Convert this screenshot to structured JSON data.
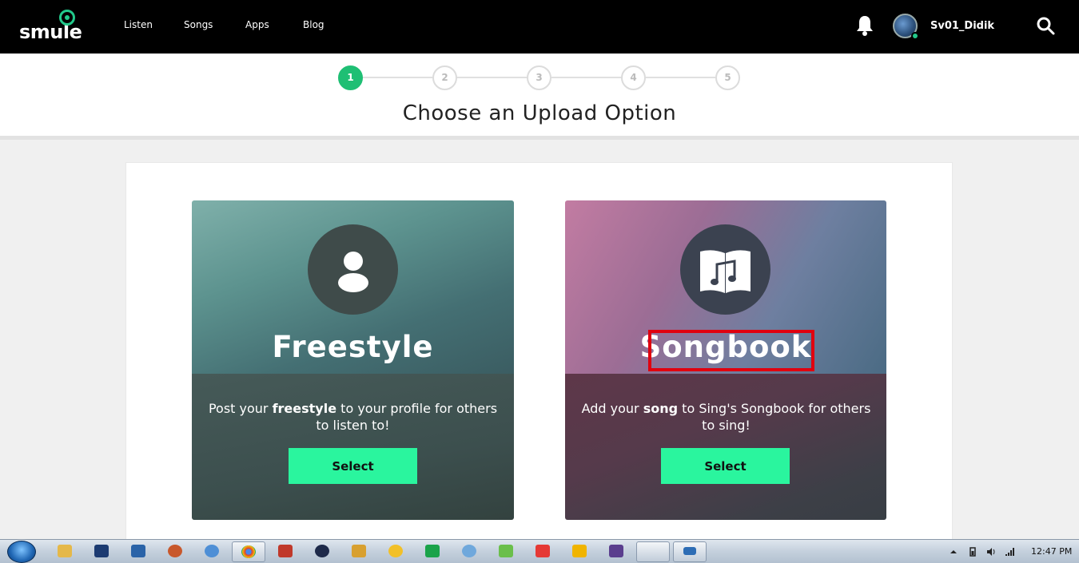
{
  "nav": {
    "logo_text": "smule",
    "links": [
      "Listen",
      "Songs",
      "Apps",
      "Blog"
    ],
    "username": "Sv01_Didik"
  },
  "stepper": {
    "steps": [
      "1",
      "2",
      "3",
      "4",
      "5"
    ],
    "active_step": 1,
    "title": "Choose an Upload Option"
  },
  "cards": {
    "freestyle": {
      "title": "Freestyle",
      "desc_before": "Post your ",
      "desc_bold": "freestyle",
      "desc_after": " to your profile for others to listen to!",
      "button": "Select",
      "icon": "person-icon"
    },
    "songbook": {
      "title": "Songbook",
      "desc_before": "Add your ",
      "desc_bold": "song",
      "desc_after": " to Sing's Songbook for others to sing!",
      "button": "Select",
      "icon": "songbook-icon"
    }
  },
  "taskbar": {
    "clock": "12:47 PM"
  },
  "colors": {
    "accent_green": "#1fbf74",
    "select_button": "#2af59e",
    "highlight_red": "#e0000f"
  }
}
